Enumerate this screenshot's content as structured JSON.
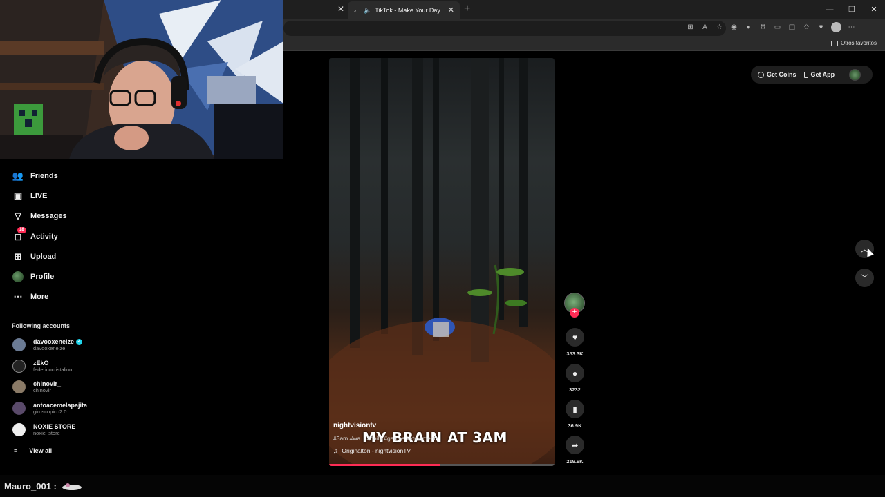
{
  "browser": {
    "tab_title": "TikTok - Make Your Day",
    "bookmark_other": "Otros favoritos",
    "window_buttons": [
      "—",
      "❐",
      "✕"
    ]
  },
  "sidebar": {
    "nav": [
      {
        "label": "Friends",
        "icon": "friends-icon"
      },
      {
        "label": "LIVE",
        "icon": "live-icon"
      },
      {
        "label": "Messages",
        "icon": "messages-icon"
      },
      {
        "label": "Activity",
        "icon": "activity-icon",
        "badge": "18"
      },
      {
        "label": "Upload",
        "icon": "upload-icon"
      },
      {
        "label": "Profile",
        "icon": "profile-icon"
      },
      {
        "label": "More",
        "icon": "more-icon"
      }
    ],
    "following_title": "Following accounts",
    "accounts": [
      {
        "name": "davooxeneize",
        "username": "davooxeneize",
        "verified": true
      },
      {
        "name": "zEkO",
        "username": "federicocristalino"
      },
      {
        "name": "chinovlr_",
        "username": "chinovlr_"
      },
      {
        "name": "antoacemelapajita",
        "username": "giroscopico2.0"
      },
      {
        "name": "NOXIE STORE",
        "username": "noxie_store"
      }
    ],
    "view_all": "View all"
  },
  "top_actions": {
    "get_coins": "Get Coins",
    "get_app": "Get App"
  },
  "video": {
    "author": "nightvisiontv",
    "hashtags": "#3am #wa... #daily #games #vtmoments",
    "music": "Originalton - nightvisionTV",
    "overlay_text": "MY BRAIN AT 3AM",
    "progress": 0.49
  },
  "rail": {
    "likes": "353.3K",
    "comments": "3232",
    "saves": "36.9K",
    "shares": "219.9K"
  },
  "stream": {
    "chat_user": "Mauro_001 :"
  },
  "colors": {
    "accent": "#fe2c55",
    "verified": "#20d5ec",
    "background": "#000000"
  }
}
